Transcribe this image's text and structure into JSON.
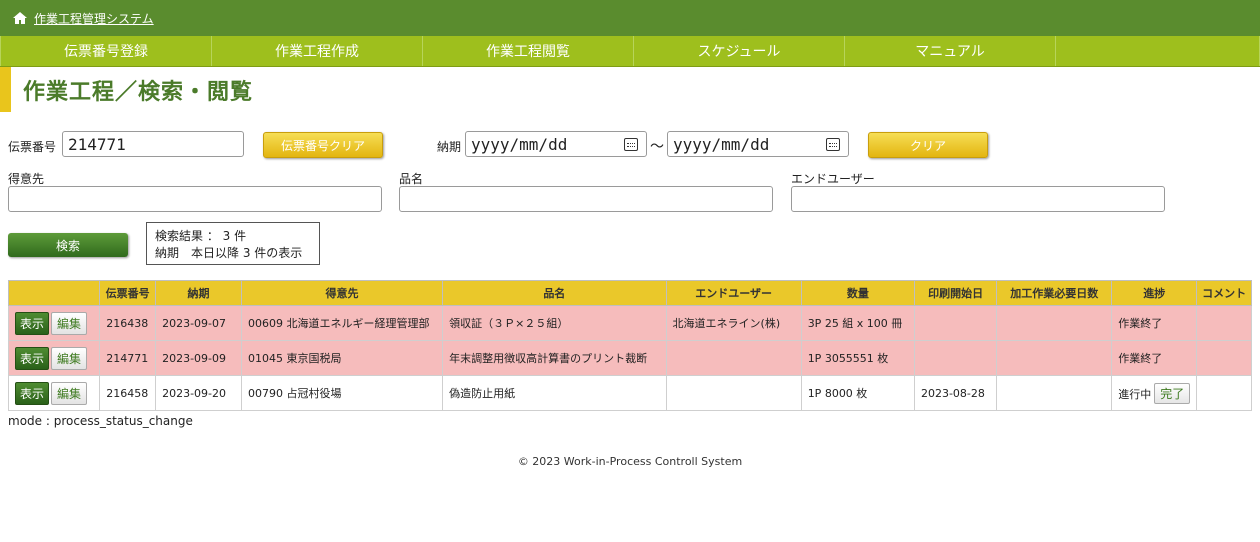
{
  "header": {
    "title": "作業工程管理システム"
  },
  "nav": {
    "items": [
      "伝票番号登録",
      "作業工程作成",
      "作業工程閲覧",
      "スケジュール",
      "マニュアル"
    ]
  },
  "page_title": "作業工程／検索・閲覧",
  "search": {
    "slip_label": "伝票番号",
    "slip_value": "214771",
    "slip_clear": "伝票番号クリア",
    "due_label": "納期",
    "date_from": "yyyy/mm/dd",
    "date_sep": "～",
    "date_to": "yyyy/mm/dd",
    "clear": "クリア",
    "customer_label": "得意先",
    "customer_value": "",
    "product_label": "品名",
    "product_value": "",
    "enduser_label": "エンドユーザー",
    "enduser_value": "",
    "search_button": "検索"
  },
  "result": {
    "line1": "検索結果 ： 3 件",
    "line2": "納期　本日以降 3 件の表示"
  },
  "table": {
    "headers": [
      "",
      "伝票番号",
      "納期",
      "得意先",
      "品名",
      "エンドユーザー",
      "数量",
      "印刷開始日",
      "加工作業必要日数",
      "進捗",
      "コメント"
    ],
    "view_label": "表示",
    "edit_label": "編集",
    "done_label": "完了",
    "rows": [
      {
        "slip": "216438",
        "due": "2023-09-07",
        "customer": "00609 北海道エネルギー経理管理部",
        "product": "領収証（３Ｐ×２５組）",
        "enduser": "北海道エネライン(株)",
        "qty": "3P 25 組 x 100 冊",
        "print_start": "",
        "days": "",
        "progress": "作業終了",
        "comment": "",
        "style": "pink"
      },
      {
        "slip": "214771",
        "due": "2023-09-09",
        "customer": "01045 東京国税局",
        "product": "年末調整用徴収高計算書のプリント裁断",
        "enduser": "",
        "qty": "1P 3055551 枚",
        "print_start": "",
        "days": "",
        "progress": "作業終了",
        "comment": "",
        "style": "pink"
      },
      {
        "slip": "216458",
        "due": "2023-09-20",
        "customer": "00790 占冠村役場",
        "product": "偽造防止用紙",
        "enduser": "",
        "qty": "1P 8000 枚",
        "print_start": "2023-08-28",
        "days": "",
        "progress": "進行中",
        "comment": "",
        "style": "white",
        "done_button": true
      }
    ]
  },
  "mode_text": "mode : process_status_change",
  "footer": "© 2023 Work-in-Process Controll System"
}
